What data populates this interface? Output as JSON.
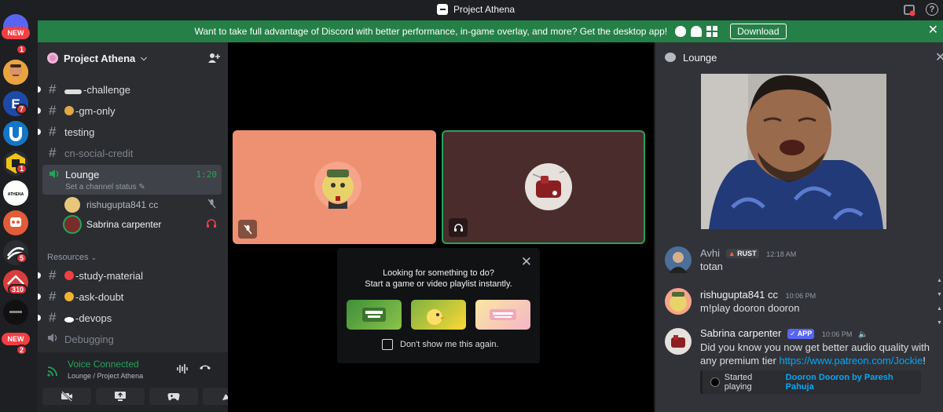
{
  "titlebar": {
    "app_title": "Project Athena"
  },
  "banner": {
    "text": "Want to take full advantage of Discord with better performance, in-game overlay, and more? Get the desktop app!",
    "download_label": "Download",
    "close": "✕"
  },
  "guilds": {
    "new_label": "NEW",
    "badges": [
      "1",
      "7",
      "1",
      "5",
      "310",
      "2"
    ],
    "athena_label": "ATHENA"
  },
  "sidebar": {
    "server_name": "Project Athena",
    "channels": [
      {
        "name": "-challenge"
      },
      {
        "name": "-gm-only"
      },
      {
        "name": "testing"
      },
      {
        "name": "cn-social-credit"
      }
    ],
    "voice_channel": {
      "name": "Lounge",
      "timer": "1:20",
      "status": "Set a channel status"
    },
    "voice_users": [
      {
        "name": "rishugupta841 cc"
      },
      {
        "name": "Sabrina carpenter"
      }
    ],
    "category": "Resources",
    "resource_channels": [
      {
        "name": "-study-material"
      },
      {
        "name": "-ask-doubt"
      },
      {
        "name": "-devops"
      },
      {
        "name": "Debugging"
      }
    ],
    "voice_connected": {
      "title": "Voice Connected",
      "subtitle": "Lounge / Project Athena"
    }
  },
  "activity": {
    "line1": "Looking for something to do?",
    "line2": "Start a game or video playlist instantly.",
    "checkbox_label": "Don't show me this again."
  },
  "chat": {
    "title": "Lounge",
    "messages": [
      {
        "author": "Avhi",
        "tag": "RUST",
        "time": "12:18 AM",
        "text": "totan"
      },
      {
        "author": "rishugupta841 cc",
        "time": "10:06 PM",
        "text": "m!play dooron dooron"
      },
      {
        "author": "Sabrina carpenter",
        "tag": "APP",
        "time": "10:06 PM",
        "text": "Did you know you now get better audio quality with any premium tier ",
        "link": "https://www.patreon.com/Jockie",
        "text_end": "!"
      }
    ],
    "embed": {
      "prefix": "Started playing",
      "song": "Dooron Dooron by Paresh Pahuja"
    }
  },
  "colors": {
    "banner_green": "#248046",
    "voice_green": "#23a55a",
    "tile_left": "#ee9072",
    "tile_right": "#4a2c2d",
    "link": "#00a8fc"
  }
}
